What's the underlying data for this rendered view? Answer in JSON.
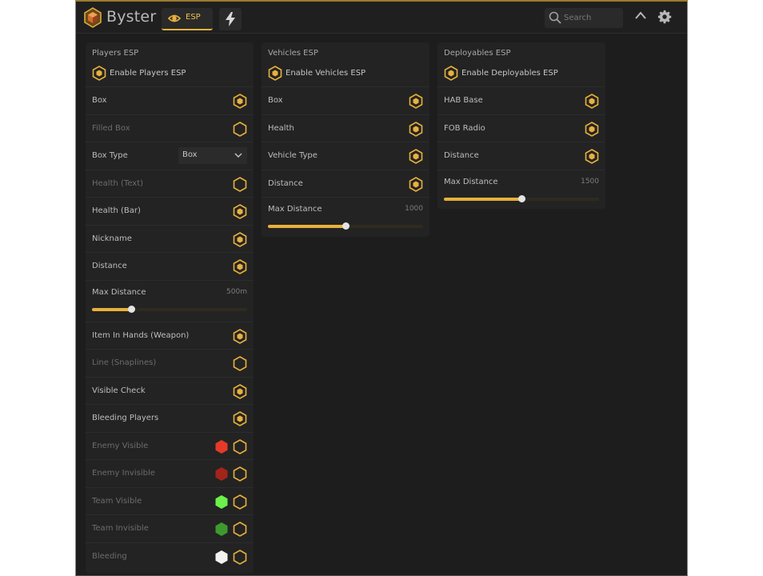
{
  "app": {
    "title": "Byster"
  },
  "tabs": [
    {
      "label": "ESP",
      "icon": "eye-icon",
      "active": true
    },
    {
      "label": "",
      "icon": "lightning-icon",
      "active": false
    }
  ],
  "search": {
    "placeholder": "Search"
  },
  "colors": {
    "accent": "#e8b13c",
    "enemy_visible": "#e53a2a",
    "enemy_invisible": "#a3241b",
    "team_visible": "#6cf04a",
    "team_invisible": "#3e9a2e",
    "bleeding": "#f2f2f2"
  },
  "players": {
    "title": "Players ESP",
    "enable": {
      "label": "Enable Players ESP",
      "on": true
    },
    "rows": [
      {
        "label": "Box",
        "on": true
      },
      {
        "label": "Filled Box",
        "on": false,
        "dim": true
      },
      {
        "label": "Box Type",
        "select": "Box"
      },
      {
        "label": "Health (Text)",
        "on": false,
        "dim": true
      },
      {
        "label": "Health (Bar)",
        "on": true
      },
      {
        "label": "Nickname",
        "on": true
      },
      {
        "label": "Distance",
        "on": true
      },
      {
        "label": "Max Distance",
        "value": "500m",
        "slider": 0.25
      },
      {
        "label": "Item In Hands (Weapon)",
        "on": true
      },
      {
        "label": "Line (Snaplines)",
        "on": false,
        "dim": true
      },
      {
        "label": "Visible Check",
        "on": true
      },
      {
        "label": "Bleeding Players",
        "on": true
      },
      {
        "label": "Enemy Visible",
        "on": false,
        "dim": true,
        "swatch": "#e53a2a"
      },
      {
        "label": "Enemy Invisible",
        "on": false,
        "dim": true,
        "swatch": "#a3241b"
      },
      {
        "label": "Team Visible",
        "on": false,
        "dim": true,
        "swatch": "#6cf04a"
      },
      {
        "label": "Team Invisible",
        "on": false,
        "dim": true,
        "swatch": "#3e9a2e"
      },
      {
        "label": "Bleeding",
        "on": false,
        "dim": true,
        "swatch": "#f2f2f2"
      }
    ]
  },
  "vehicles": {
    "title": "Vehicles ESP",
    "enable": {
      "label": "Enable Vehicles ESP",
      "on": true
    },
    "rows": [
      {
        "label": "Box",
        "on": true
      },
      {
        "label": "Health",
        "on": true
      },
      {
        "label": "Vehicle Type",
        "on": true
      },
      {
        "label": "Distance",
        "on": true
      },
      {
        "label": "Max Distance",
        "value": "1000",
        "slider": 0.5
      }
    ]
  },
  "deployables": {
    "title": "Deployables ESP",
    "enable": {
      "label": "Enable Deployables ESP",
      "on": true
    },
    "rows": [
      {
        "label": "HAB Base",
        "on": true
      },
      {
        "label": "FOB Radio",
        "on": true
      },
      {
        "label": "Distance",
        "on": true
      },
      {
        "label": "Max Distance",
        "value": "1500",
        "slider": 0.5
      }
    ]
  }
}
